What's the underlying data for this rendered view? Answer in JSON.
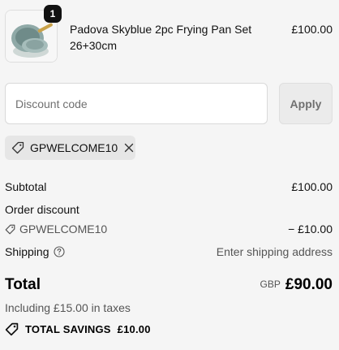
{
  "cart": {
    "item": {
      "quantity": "1",
      "name": "Padova Skyblue 2pc Frying Pan Set 26+30cm",
      "price": "£100.00"
    }
  },
  "discount": {
    "placeholder": "Discount code",
    "apply_label": "Apply",
    "applied_code": "GPWELCOME10"
  },
  "summary": {
    "subtotal_label": "Subtotal",
    "subtotal_value": "£100.00",
    "order_discount_label": "Order discount",
    "discount_code": "GPWELCOME10",
    "discount_value": "− £10.00",
    "shipping_label": "Shipping",
    "shipping_value": "Enter shipping address",
    "total_label": "Total",
    "currency": "GBP",
    "total_value": "£90.00",
    "tax_note": "Including £15.00 in taxes",
    "savings_label": "TOTAL SAVINGS",
    "savings_value": "£10.00"
  },
  "icons": {
    "tag": "tag-icon",
    "remove": "close-icon",
    "help": "question-circle-icon"
  }
}
